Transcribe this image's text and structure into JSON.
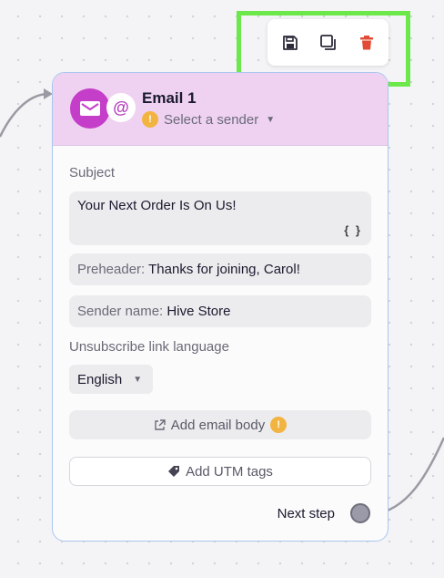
{
  "toolbar": {
    "icons": [
      "save-icon",
      "duplicate-icon",
      "trash-icon"
    ],
    "delete_color": "#e24b35"
  },
  "node": {
    "title": "Email 1",
    "sender_select": "Select a sender",
    "subject_label": "Subject",
    "subject_value": "Your Next Order Is On Us!",
    "personalize_symbol": "{ }",
    "preheader_key": "Preheader:",
    "preheader_value": "Thanks for joining, Carol!",
    "sender_name_key": "Sender name:",
    "sender_name_value": "Hive Store",
    "unsubscribe_label": "Unsubscribe link language",
    "language_value": "English",
    "add_body_label": "Add email body",
    "add_utm_label": "Add UTM tags",
    "next_step_label": "Next step",
    "at_symbol": "@",
    "header_color": "#efd2f2",
    "accent_color": "#c53ec9",
    "warning_color": "#f2b441",
    "highlight_color": "#6de84a"
  }
}
